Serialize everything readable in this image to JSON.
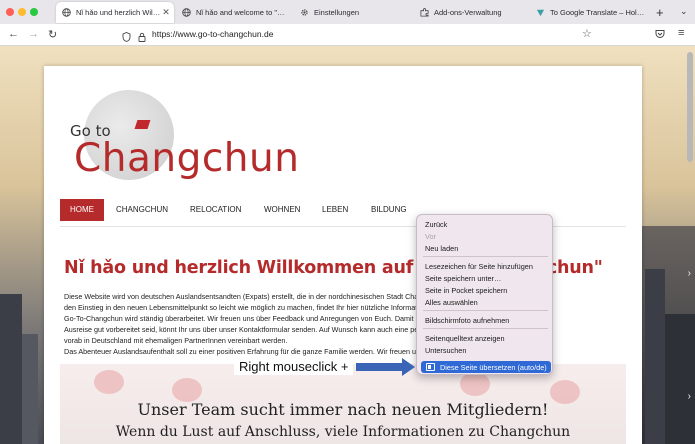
{
  "tabs": [
    {
      "label": "Nǐ hǎo und herzlich Willkommen",
      "icon": "globe-icon",
      "active": true
    },
    {
      "label": "Nǐ hǎo and welcome to \"Go to",
      "icon": "globe-icon",
      "active": false
    },
    {
      "label": "Einstellungen",
      "icon": "gear-icon",
      "active": false
    },
    {
      "label": "Add-ons-Verwaltung",
      "icon": "puzzle-icon",
      "active": false
    },
    {
      "label": "To Google Translate – Holen Si",
      "icon": "translate-icon",
      "active": false
    }
  ],
  "toolbar": {
    "url": "https://www.go-to-changchun.de"
  },
  "site": {
    "logo_small": "Go to",
    "logo_big": "Changchun",
    "nav": [
      "HOME",
      "CHANGCHUN",
      "RELOCATION",
      "WOHNEN",
      "LEBEN",
      "BILDUNG"
    ],
    "headline": "Nǐ hǎo und herzlich Willkommen auf \"Go to Changchun\"",
    "body_lines": [
      "Diese Website wird von deutschen Auslandsentsandten (Expats) erstellt, die in der nordchinesischen Stadt Changchun arbeiten und leben. Um Euch",
      "den Einstieg in den neuen Lebensmittelpunkt so leicht wie möglich zu machen, findet Ihr hier nützliche Informationen rund um Changchun.",
      "Go-To-Changchun wird ständig überarbeitet. Wir freuen uns über Feedback und Anregungen von Euch. Damit Ihr für Eure",
      "Ausreise gut vorbereitet seid, könnt Ihr uns über unser Kontaktformular senden. Auf Wunsch kann auch eine persönliche Kontaktaufnahme",
      "vorab in Deutschland mit ehemaligen PartnerInnen vereinbart werden.",
      "Das Abenteuer Auslandsaufenthalt soll zu einer positiven Erfahrung für die ganze Familie werden. Wir freuen uns auf Euch!"
    ],
    "banner_title": "Unser Team sucht immer nach neuen Mitgliedern!",
    "banner_sub": "Wenn du Lust auf Anschluss, viele Informationen zu Changchun"
  },
  "context_menu": {
    "items": [
      {
        "label": "Zurück",
        "disabled": false
      },
      {
        "label": "Vor",
        "disabled": true
      },
      {
        "label": "Neu laden",
        "disabled": false
      },
      {
        "label": "Lesezeichen für Seite hinzufügen",
        "disabled": false
      },
      {
        "label": "Seite speichern unter…",
        "disabled": false
      },
      {
        "label": "Seite in Pocket speichern",
        "disabled": false
      },
      {
        "label": "Alles auswählen",
        "disabled": false
      },
      {
        "label": "Bildschirmfoto aufnehmen",
        "disabled": false
      },
      {
        "label": "Seitenquelltext anzeigen",
        "disabled": false
      },
      {
        "label": "Untersuchen",
        "disabled": false
      }
    ],
    "highlighted": "Diese Seite übersetzen (auto/de)",
    "accent_color": "#2f69d5"
  },
  "annotation": {
    "label": "Right mouseclick +",
    "arrow_color": "#3a64b5"
  }
}
